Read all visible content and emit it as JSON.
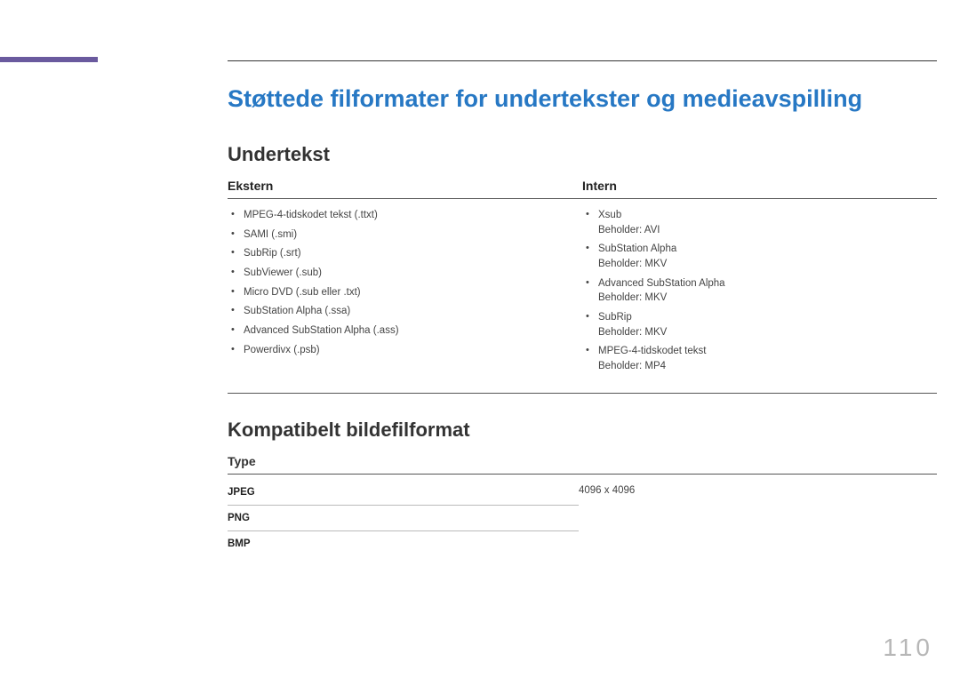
{
  "page_number": "110",
  "title": "Støttede filformater for undertekster og medieavspilling",
  "section1": {
    "heading": "Undertekst",
    "left_head": "Ekstern",
    "right_head": "Intern",
    "ekstern": [
      "MPEG-4-tidskodet tekst (.ttxt)",
      "SAMI (.smi)",
      "SubRip (.srt)",
      "SubViewer (.sub)",
      "Micro DVD (.sub eller .txt)",
      "SubStation Alpha (.ssa)",
      "Advanced SubStation Alpha (.ass)",
      "Powerdivx (.psb)"
    ],
    "intern": [
      {
        "main": "Xsub",
        "sub": "Beholder: AVI"
      },
      {
        "main": "SubStation Alpha",
        "sub": "Beholder: MKV"
      },
      {
        "main": "Advanced SubStation Alpha",
        "sub": "Beholder: MKV"
      },
      {
        "main": "SubRip",
        "sub": "Beholder: MKV"
      },
      {
        "main": "MPEG-4-tidskodet tekst",
        "sub": "Beholder: MP4"
      }
    ]
  },
  "section2": {
    "heading": "Kompatibelt bildefilformat",
    "col_head": "Type",
    "rows": [
      {
        "label": "JPEG",
        "value": "4096 x 4096"
      },
      {
        "label": "PNG",
        "value": ""
      },
      {
        "label": "BMP",
        "value": ""
      }
    ]
  }
}
